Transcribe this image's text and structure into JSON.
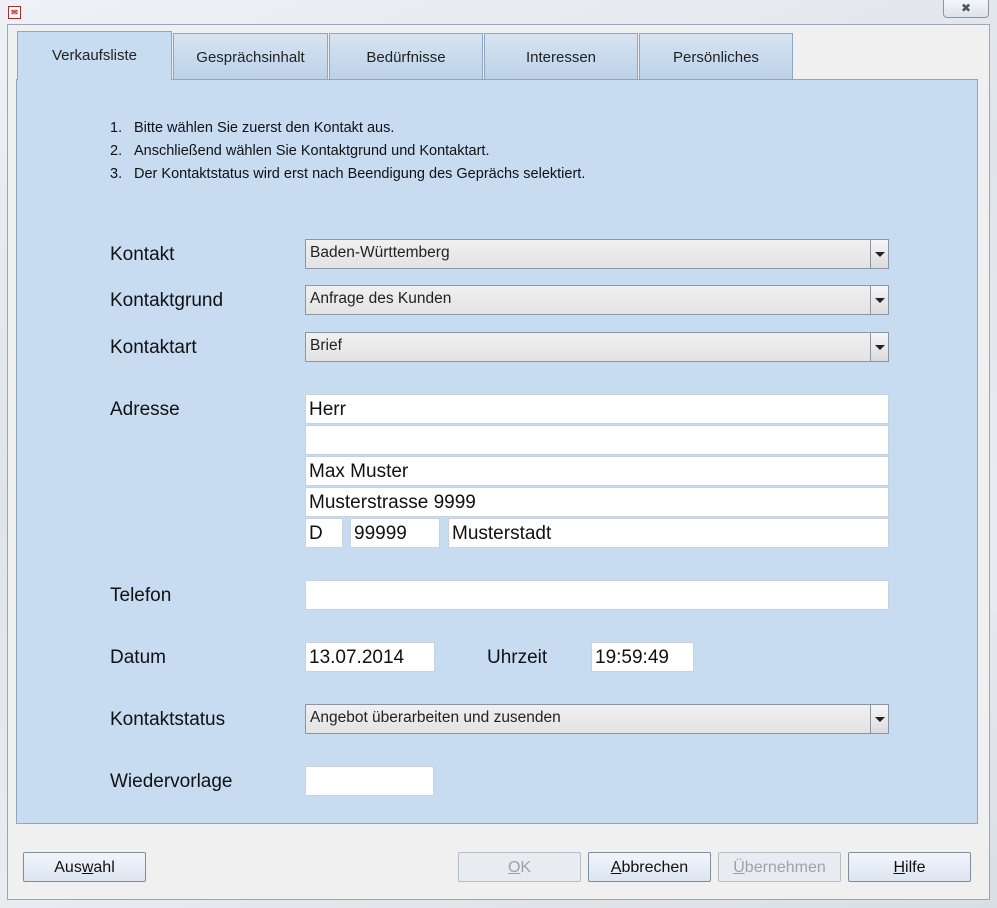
{
  "window": {
    "close_glyph": "✖︎",
    "icon": "app-icon"
  },
  "tabs": [
    {
      "label": "Verkaufsliste",
      "active": true
    },
    {
      "label": "Gesprächsinhalt",
      "active": false
    },
    {
      "label": "Bedürfnisse",
      "active": false
    },
    {
      "label": "Interessen",
      "active": false
    },
    {
      "label": "Persönliches",
      "active": false
    }
  ],
  "instructions": [
    {
      "num": "1.",
      "text": "Bitte wählen Sie zuerst den Kontakt aus."
    },
    {
      "num": "2.",
      "text": "Anschließend wählen Sie Kontaktgrund und Kontaktart."
    },
    {
      "num": "3.",
      "text": "Der Kontaktstatus wird erst nach Beendigung des Geprächs selektiert."
    }
  ],
  "form": {
    "kontakt": {
      "label": "Kontakt",
      "value": "Baden-Württemberg"
    },
    "kontaktgrund": {
      "label": "Kontaktgrund",
      "value": "Anfrage des Kunden"
    },
    "kontaktart": {
      "label": "Kontaktart",
      "value": "Brief"
    },
    "adresse": {
      "label": "Adresse",
      "line1": "Herr",
      "line2": "",
      "line3": "Max Muster",
      "line4": "Musterstrasse 9999",
      "country": "D",
      "zip": "99999",
      "city": "Musterstadt"
    },
    "telefon": {
      "label": "Telefon",
      "value": ""
    },
    "datum": {
      "label": "Datum",
      "value": "13.07.2014"
    },
    "uhrzeit": {
      "label": "Uhrzeit",
      "value": "19:59:49"
    },
    "kontaktstatus": {
      "label": "Kontaktstatus",
      "value": "Angebot überarbeiten und zusenden"
    },
    "wiedervorlage": {
      "label": "Wiedervorlage",
      "value": ""
    }
  },
  "buttons": {
    "auswahl": {
      "pre": "Aus",
      "key": "w",
      "post": "ahl",
      "enabled": true
    },
    "ok": {
      "pre": "",
      "key": "O",
      "post": "K",
      "enabled": false
    },
    "abbrechen": {
      "pre": "",
      "key": "A",
      "post": "bbrechen",
      "enabled": true
    },
    "uebernehmen": {
      "pre": "",
      "key": "Ü",
      "post": "bernehmen",
      "enabled": false
    },
    "hilfe": {
      "pre": "",
      "key": "H",
      "post": "ilfe",
      "enabled": true
    }
  }
}
